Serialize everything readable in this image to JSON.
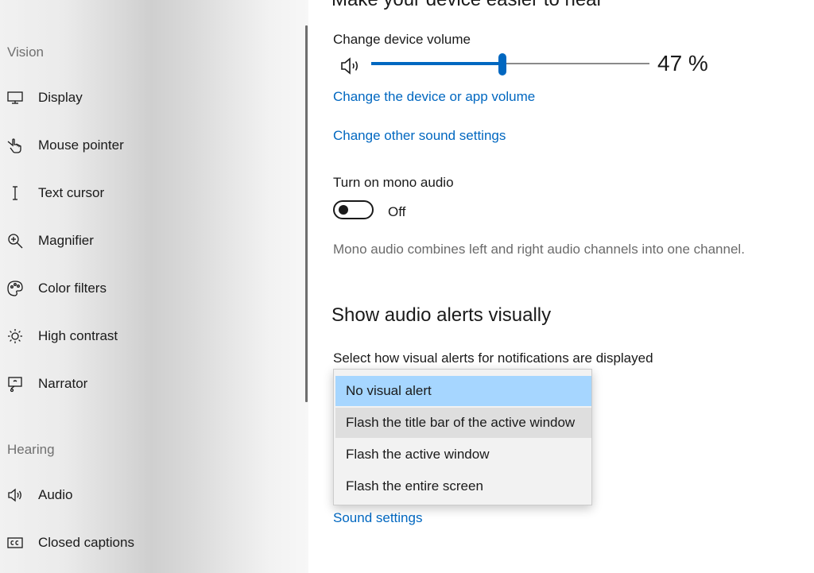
{
  "sidebar": {
    "sections": [
      {
        "label": "Vision"
      },
      {
        "label": "Hearing"
      }
    ],
    "items": [
      {
        "label": "Display",
        "icon": "monitor-icon"
      },
      {
        "label": "Mouse pointer",
        "icon": "mouse-pointer-icon"
      },
      {
        "label": "Text cursor",
        "icon": "text-cursor-icon"
      },
      {
        "label": "Magnifier",
        "icon": "magnifier-icon"
      },
      {
        "label": "Color filters",
        "icon": "palette-icon"
      },
      {
        "label": "High contrast",
        "icon": "sun-icon"
      },
      {
        "label": "Narrator",
        "icon": "narrator-icon"
      },
      {
        "label": "Audio",
        "icon": "speaker-icon"
      },
      {
        "label": "Closed captions",
        "icon": "closed-captions-icon"
      }
    ]
  },
  "main": {
    "cut_heading": "Make your device easier to hear",
    "volume": {
      "label": "Change device volume",
      "value": 47,
      "value_text": "47 %"
    },
    "links": {
      "device_app_volume": "Change the device or app volume",
      "other_sound": "Change other sound settings",
      "sound_settings": "Sound settings"
    },
    "mono": {
      "label": "Turn on mono audio",
      "state": "Off",
      "description": "Mono audio combines left and right audio channels into one channel."
    },
    "alerts": {
      "heading": "Show audio alerts visually",
      "select_label": "Select how visual alerts for notifications are displayed",
      "options": [
        "No visual alert",
        "Flash the title bar of the active window",
        "Flash the active window",
        "Flash the entire screen"
      ],
      "selected_index": 0
    }
  },
  "colors": {
    "accent": "#0067c0",
    "selected_option": "#a6d6ff",
    "description_text": "#6b6b6b"
  }
}
